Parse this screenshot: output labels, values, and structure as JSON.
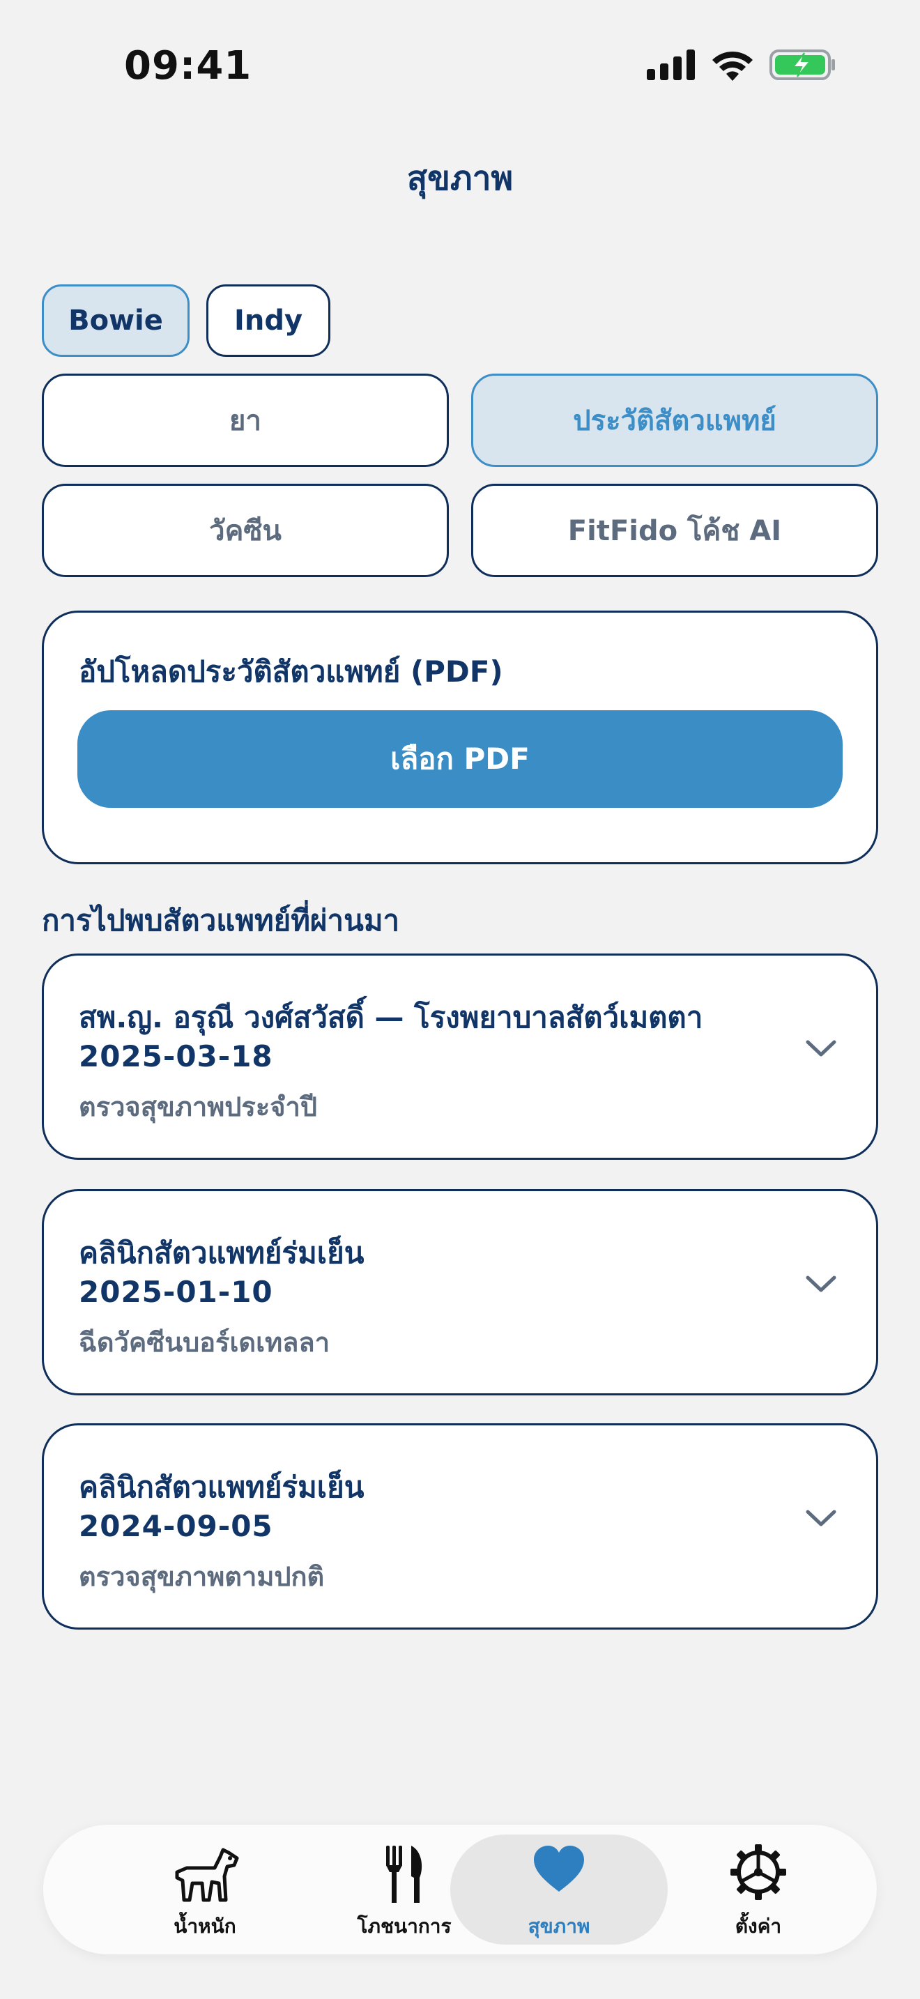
{
  "status_bar": {
    "time": "09:41"
  },
  "header": {
    "title": "สุขภาพ"
  },
  "pets": [
    {
      "name": "Bowie",
      "selected": true
    },
    {
      "name": "Indy",
      "selected": false
    }
  ],
  "segments": [
    {
      "label": "ยา",
      "selected": false
    },
    {
      "label": "ประวัติสัตวแพทย์",
      "selected": true
    },
    {
      "label": "วัคซีน",
      "selected": false
    },
    {
      "label": "FitFido โค้ช AI",
      "selected": false
    }
  ],
  "upload": {
    "title": "อัปโหลดประวัติสัตวแพทย์ (PDF)",
    "button_label": "เลือก PDF"
  },
  "past_visits": {
    "title": "การไปพบสัตวแพทย์ที่ผ่านมา",
    "items": [
      {
        "clinic": "สพ.ญ. อรุณี วงศ์สวัสดิ์ — โรงพยาบาลสัตว์เมตตา",
        "date": "2025-03-18",
        "note": "ตรวจสุขภาพประจำปี"
      },
      {
        "clinic": "คลินิกสัตวแพทย์ร่มเย็น",
        "date": "2025-01-10",
        "note": "ฉีดวัคซีนบอร์เดเทลลา"
      },
      {
        "clinic": "คลินิกสัตวแพทย์ร่มเย็น",
        "date": "2024-09-05",
        "note": "ตรวจสุขภาพตามปกติ"
      }
    ]
  },
  "tabbar": {
    "items": [
      {
        "label": "น้ำหนัก",
        "icon": "dog-icon",
        "active": false
      },
      {
        "label": "โภชนาการ",
        "icon": "utensils-icon",
        "active": false
      },
      {
        "label": "สุขภาพ",
        "icon": "heart-icon",
        "active": true
      },
      {
        "label": "ตั้งค่า",
        "icon": "gear-icon",
        "active": false
      }
    ]
  },
  "colors": {
    "accent": "#3b8ec5",
    "navy": "#0f2f5a",
    "battery_green": "#34c759"
  }
}
